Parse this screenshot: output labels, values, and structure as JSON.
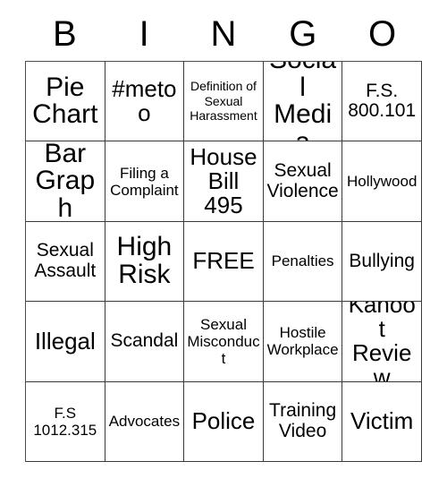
{
  "card": {
    "header_letters": [
      "B",
      "I",
      "N",
      "G",
      "O"
    ],
    "free_space_label": "FREE",
    "rows": [
      [
        {
          "text": "Pie\nChart",
          "size": "xl"
        },
        {
          "text": "#metoo",
          "size": "lg"
        },
        {
          "text": "Definition of\nSexual\nHarassment",
          "size": "xs"
        },
        {
          "text": "Social\nMedia",
          "size": "xl"
        },
        {
          "text": "F.S.\n800.101",
          "size": "md"
        }
      ],
      [
        {
          "text": "Bar\nGraph",
          "size": "xl"
        },
        {
          "text": "Filing a\nComplaint",
          "size": "sm"
        },
        {
          "text": "House\nBill 495",
          "size": "lg"
        },
        {
          "text": "Sexual\nViolence",
          "size": "md"
        },
        {
          "text": "Hollywood",
          "size": "sm"
        }
      ],
      [
        {
          "text": "Sexual\nAssault",
          "size": "md"
        },
        {
          "text": "High\nRisk",
          "size": "xl"
        },
        {
          "text": "FREE",
          "size": "lg"
        },
        {
          "text": "Penalties",
          "size": "sm"
        },
        {
          "text": "Bullying",
          "size": "md"
        }
      ],
      [
        {
          "text": "Illegal",
          "size": "lg"
        },
        {
          "text": "Scandal",
          "size": "md"
        },
        {
          "text": "Sexual\nMisconduct",
          "size": "sm"
        },
        {
          "text": "Hostile\nWorkplace",
          "size": "sm"
        },
        {
          "text": "Kahoot\nReview",
          "size": "lg"
        }
      ],
      [
        {
          "text": "F.S\n1012.315",
          "size": "sm"
        },
        {
          "text": "Advocates",
          "size": "sm"
        },
        {
          "text": "Police",
          "size": "lg"
        },
        {
          "text": "Training\nVideo",
          "size": "md"
        },
        {
          "text": "Victim",
          "size": "lg"
        }
      ]
    ]
  },
  "colors": {
    "background": "#ffffff",
    "text": "#000000",
    "grid_line": "#3a3a3a"
  }
}
